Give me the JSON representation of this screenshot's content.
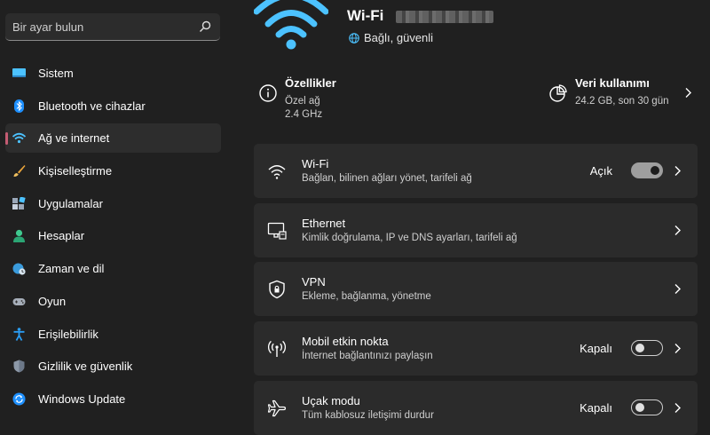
{
  "search": {
    "placeholder": "Bir ayar bulun"
  },
  "sidebar": {
    "items": [
      {
        "label": "Sistem",
        "icon": "monitor-icon",
        "active": false
      },
      {
        "label": "Bluetooth ve cihazlar",
        "icon": "bluetooth-icon",
        "active": false
      },
      {
        "label": "Ağ ve internet",
        "icon": "wifi-icon",
        "active": true
      },
      {
        "label": "Kişiselleştirme",
        "icon": "brush-icon",
        "active": false
      },
      {
        "label": "Uygulamalar",
        "icon": "apps-icon",
        "active": false
      },
      {
        "label": "Hesaplar",
        "icon": "person-icon",
        "active": false
      },
      {
        "label": "Zaman ve dil",
        "icon": "globe-clock-icon",
        "active": false
      },
      {
        "label": "Oyun",
        "icon": "gamepad-icon",
        "active": false
      },
      {
        "label": "Erişilebilirlik",
        "icon": "accessibility-icon",
        "active": false
      },
      {
        "label": "Gizlilik ve güvenlik",
        "icon": "shield-icon",
        "active": false
      },
      {
        "label": "Windows Update",
        "icon": "update-icon",
        "active": false
      }
    ]
  },
  "header": {
    "name": "Wi-Fi",
    "status": "Bağlı, güvenli"
  },
  "properties": {
    "title": "Özellikler",
    "line1": "Özel ağ",
    "line2": "2.4 GHz"
  },
  "usage": {
    "title": "Veri kullanımı",
    "line1": "24.2 GB, son 30 gün"
  },
  "cards": [
    {
      "title": "Wi-Fi",
      "sub": "Bağlan, bilinen ağları yönet, tarifeli ağ",
      "toggle_label": "Açık",
      "toggle_on": true,
      "icon": "wifi-icon"
    },
    {
      "title": "Ethernet",
      "sub": "Kimlik doğrulama, IP ve DNS ayarları, tarifeli ağ",
      "icon": "ethernet-icon"
    },
    {
      "title": "VPN",
      "sub": "Ekleme, bağlanma, yönetme",
      "icon": "vpn-shield-icon"
    },
    {
      "title": "Mobil etkin nokta",
      "sub": "İnternet bağlantınızı paylaşın",
      "toggle_label": "Kapalı",
      "toggle_on": false,
      "icon": "hotspot-icon"
    },
    {
      "title": "Uçak modu",
      "sub": "Tüm kablosuz iletişimi durdur",
      "toggle_label": "Kapalı",
      "toggle_on": false,
      "icon": "airplane-icon"
    }
  ],
  "colors": {
    "accent": "#4cc2ff",
    "background": "#202020",
    "card": "#2b2b2b"
  }
}
